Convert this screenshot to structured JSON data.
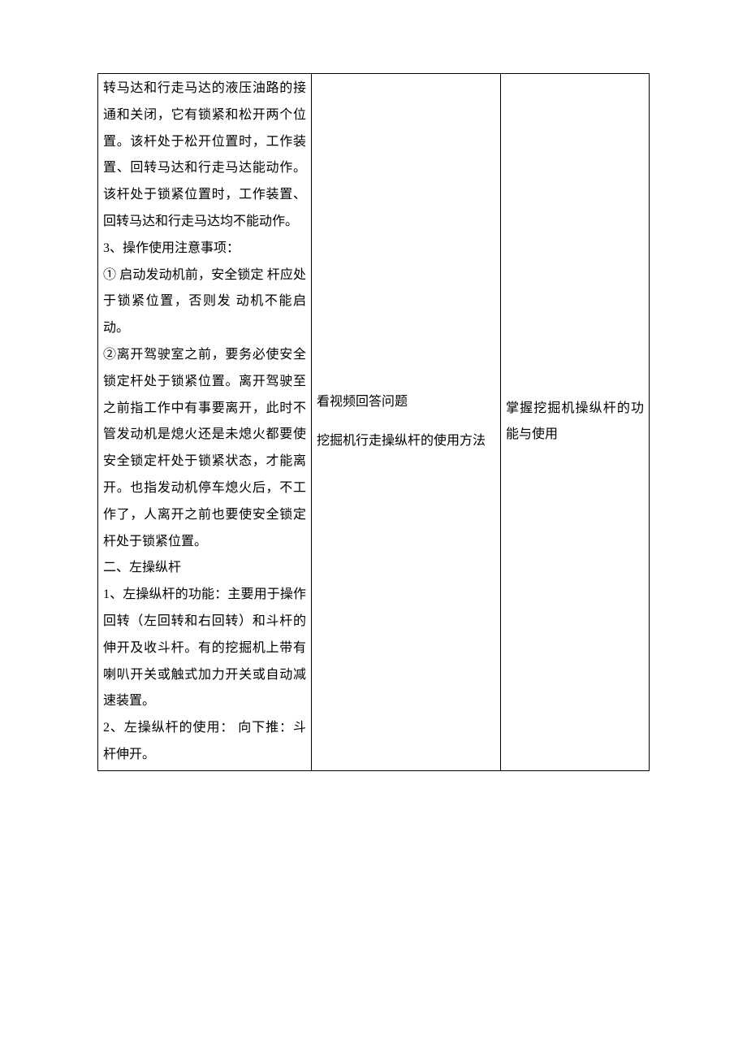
{
  "table": {
    "col1_paragraphs": [
      "转马达和行走马达的液压油路的接通和关闭，它有锁紧和松开两个位置。该杆处于松开位置时，工作装置、回转马达和行走马达能动作。该杆处于锁紧位置时，工作装置、回转马达和行走马达均不能动作。",
      "3、操作使用注意事项：",
      "①  启动发动机前，安全锁定  杆应处于锁紧位置，否则发  动机不能启动。",
      "②离开驾驶室之前，要务必使安全锁定杆处于锁紧位置。离开驾驶至之前指工作中有事要离开，此时不管发动机是熄火还是未熄火都要使安全锁定杆处于锁紧状态，才能离开。也指发动机停车熄火后，不工作了，人离开之前也要使安全锁定杆处于锁紧位置。",
      "二、左操纵杆",
      "1、左操纵杆的功能：主要用于操作回转（左回转和右回转）和斗杆的伸开及收斗杆。有的挖掘机上带有喇叭开关或触式加力开关或自动减速装置。",
      "2、左操纵杆的使用：  向下推：斗杆伸开。"
    ],
    "col2_line1": "看视频回答问题",
    "col2_line2": "挖掘机行走操纵杆的使用方法",
    "col3": "掌握挖掘机操纵杆的功能与使用"
  }
}
